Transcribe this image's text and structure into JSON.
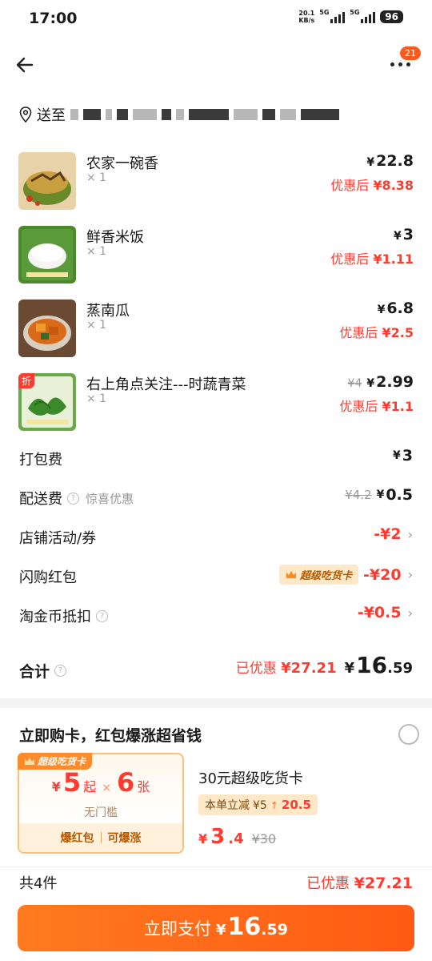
{
  "status_bar": {
    "time": "17:00",
    "net_speed_value": "20.1",
    "net_speed_unit": "KB/s",
    "sim1": "5G",
    "sim2": "5G",
    "battery": "96"
  },
  "nav": {
    "notification_count": "21"
  },
  "address": {
    "prefix": "送至"
  },
  "items": [
    {
      "name": "农家一碗香",
      "qty": "× 1",
      "price": "22.8",
      "orig_price": "",
      "disc_label": "优惠后",
      "disc_price": "8.38",
      "tag": ""
    },
    {
      "name": "鲜香米饭",
      "qty": "× 1",
      "price": "3",
      "orig_price": "",
      "disc_label": "优惠后",
      "disc_price": "1.11",
      "tag": ""
    },
    {
      "name": "蒸南瓜",
      "qty": "× 1",
      "price": "6.8",
      "orig_price": "",
      "disc_label": "优惠后",
      "disc_price": "2.5",
      "tag": ""
    },
    {
      "name": "右上角点关注---时蔬青菜",
      "qty": "× 1",
      "price": "2.99",
      "orig_price": "¥4",
      "disc_label": "优惠后",
      "disc_price": "1.1",
      "tag": "折"
    }
  ],
  "currency": "¥",
  "fees": {
    "packing": {
      "label": "打包费",
      "value": "3"
    },
    "delivery": {
      "label": "配送费",
      "sub": "惊喜优惠",
      "orig": "¥4.2",
      "value": "0.5"
    },
    "store_promo": {
      "label": "店铺活动/券",
      "value": "-¥2"
    },
    "flash_redpacket": {
      "label": "闪购红包",
      "chip": "超级吃货卡",
      "value": "-¥20"
    },
    "coins": {
      "label": "淘金币抵扣",
      "value": "-¥0.5"
    }
  },
  "total": {
    "label": "合计",
    "saved_label": "已优惠",
    "saved_value": "¥27.21",
    "amount_int": "16",
    "amount_dec": ".59"
  },
  "promo": {
    "title": "立即购卡，红包爆涨超省钱",
    "card_tag": "超级吃货卡",
    "card_amount": "5",
    "card_qi": "起",
    "card_x": "×",
    "card_count": "6",
    "card_zhang": "张",
    "card_no_threshold": "无门槛",
    "card_foot_left": "爆红包",
    "card_foot_right": "可爆涨",
    "info_title": "30元超级吃货卡",
    "info_chip_label": "本单立减",
    "info_chip_from": "¥5",
    "info_chip_to": "20.5",
    "info_price_int": "3",
    "info_price_dec": ".4",
    "info_price_orig": "¥30"
  },
  "bottom": {
    "count": "共4件",
    "saved_label": "已优惠",
    "saved_value": "¥27.21"
  },
  "pay_button": {
    "label": "立即支付",
    "amount_int": "16",
    "amount_dec": ".59"
  }
}
